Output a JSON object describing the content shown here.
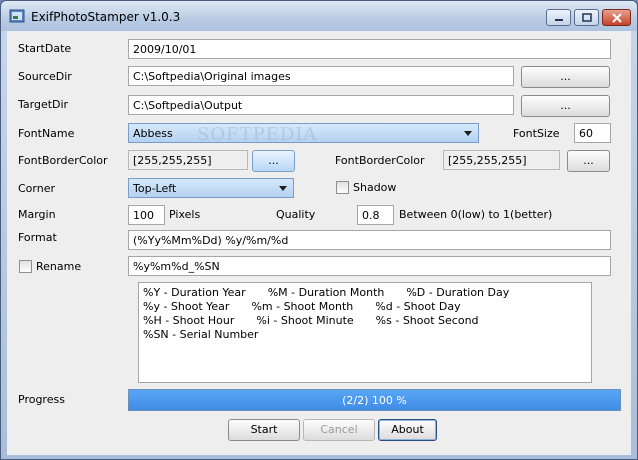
{
  "window": {
    "title": "ExifPhotoStamper v1.0.3",
    "minimize_icon": "minimize-icon",
    "maximize_icon": "maximize-icon",
    "close_icon": "close-icon"
  },
  "form": {
    "start_date": {
      "label": "StartDate",
      "value": "2009/10/01"
    },
    "source_dir": {
      "label": "SourceDir",
      "value": "C:\\Softpedia\\Original images",
      "browse_label": "..."
    },
    "target_dir": {
      "label": "TargetDir",
      "value": "C:\\Softpedia\\Output",
      "browse_label": "..."
    },
    "font_name": {
      "label": "FontName",
      "value": "Abbess"
    },
    "font_size": {
      "label": "FontSize",
      "value": "60"
    },
    "font_border_color_1": {
      "label": "FontBorderColor",
      "value": "[255,255,255]",
      "button_label": "..."
    },
    "font_border_color_2": {
      "label": "FontBorderColor",
      "value": "[255,255,255]",
      "button_label": "..."
    },
    "corner": {
      "label": "Corner",
      "value": "Top-Left"
    },
    "shadow": {
      "label": "Shadow",
      "checked": false
    },
    "margin": {
      "label": "Margin",
      "value": "100",
      "unit": "Pixels"
    },
    "quality": {
      "label": "Quality",
      "value": "0.8",
      "hint": "Between 0(low) to 1(better)"
    },
    "format": {
      "label": "Format",
      "value": "(%Yy%Mm%Dd) %y/%m/%d"
    },
    "rename": {
      "label": "Rename",
      "checked": false,
      "value": "%y%m%d_%SN"
    }
  },
  "help": {
    "rows": [
      [
        "%Y - Duration Year",
        "%M - Duration Month",
        "%D - Duration Day"
      ],
      [
        "%y - Shoot Year",
        "%m - Shoot Month",
        "%d - Shoot Day"
      ],
      [
        "%H - Shoot Hour",
        "%i - Shoot Minute",
        "%s - Shoot Second"
      ],
      [
        "%SN - Serial Number"
      ]
    ]
  },
  "progress": {
    "label": "Progress",
    "text": "(2/2) 100 %",
    "percent": 100
  },
  "buttons": {
    "start": "Start",
    "cancel": "Cancel",
    "about": "About"
  },
  "watermark": "SOFTPEDIA",
  "colors": {
    "progress_fill": "#4a98ee",
    "combo_bg": "#c6def7",
    "title_bar": "#c9d7ea"
  }
}
